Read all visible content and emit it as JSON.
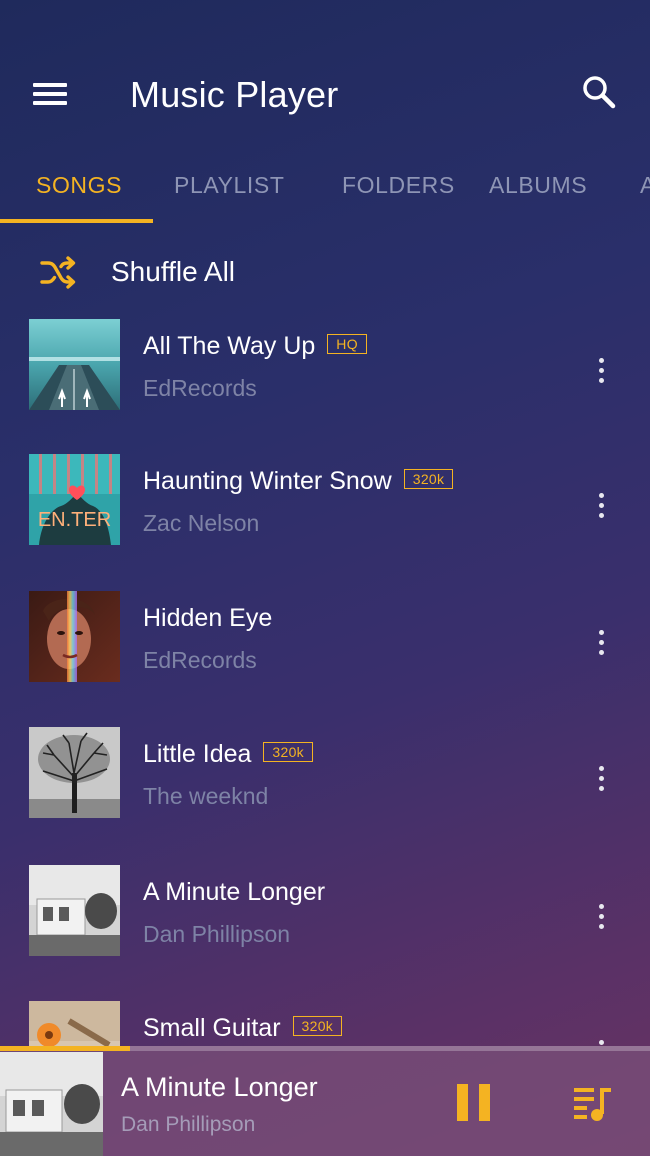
{
  "header": {
    "title": "Music Player",
    "menu_icon": "hamburger-menu-icon",
    "search_icon": "search-icon"
  },
  "tabs": [
    {
      "label": "SONGS",
      "active": true
    },
    {
      "label": "PLAYLIST",
      "active": false
    },
    {
      "label": "FOLDERS",
      "active": false
    },
    {
      "label": "ALBUMS",
      "active": false
    },
    {
      "label": "A",
      "active": false
    }
  ],
  "shuffle": {
    "label": "Shuffle All",
    "icon": "shuffle-icon"
  },
  "songs": [
    {
      "title": "All The Way Up",
      "badge": "HQ",
      "artist": "EdRecords"
    },
    {
      "title": "Haunting Winter Snow",
      "badge": "320k",
      "artist": "Zac Nelson",
      "art_text": "EN.TER"
    },
    {
      "title": "Hidden Eye",
      "badge": "",
      "artist": "EdRecords"
    },
    {
      "title": "Little Idea",
      "badge": "320k",
      "artist": "The weeknd"
    },
    {
      "title": "A Minute Longer",
      "badge": "",
      "artist": "Dan Phillipson"
    },
    {
      "title": "Small Guitar",
      "badge": "320k",
      "artist": ""
    }
  ],
  "now_playing": {
    "title": "A Minute Longer",
    "artist": "Dan Phillipson",
    "progress": 0.2,
    "pause_icon": "pause-icon",
    "queue_icon": "queue-music-icon"
  },
  "colors": {
    "accent": "#f4b322",
    "text_secondary": "#7e83a6",
    "tab_inactive": "#8e95b5"
  }
}
